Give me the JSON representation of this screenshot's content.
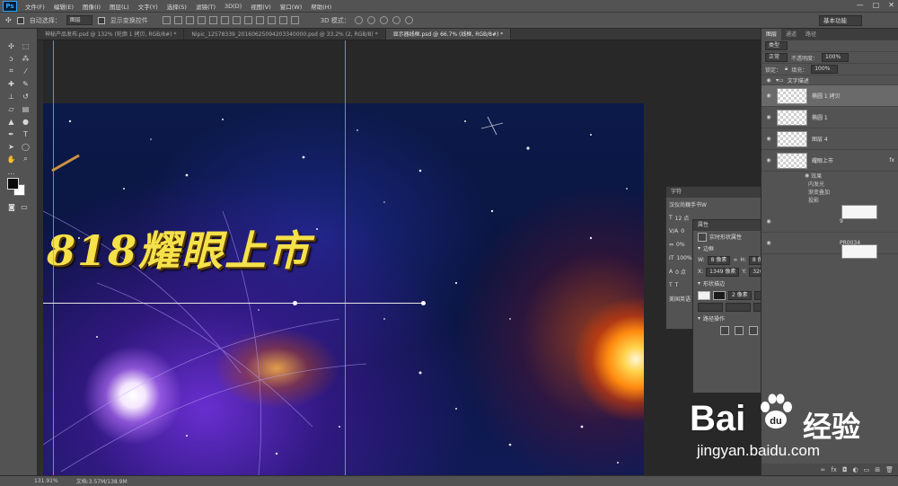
{
  "app": {
    "logo": "Ps"
  },
  "menu": [
    "文件(F)",
    "编辑(E)",
    "图像(I)",
    "图层(L)",
    "文字(Y)",
    "选择(S)",
    "滤镜(T)",
    "3D(D)",
    "视图(V)",
    "窗口(W)",
    "帮助(H)"
  ],
  "window_controls": {
    "minimize": "—",
    "maximize": "□",
    "close": "✕"
  },
  "options": {
    "auto_select_label": "自动选择：",
    "auto_select_value": "图层",
    "show_transform": "显示变换控件",
    "mode3d_label": "3D 模式：",
    "workspace": "基本功能"
  },
  "tabs": [
    {
      "label": "神秘产品发布.psd @ 132% (轮廓 1 拷贝, RGB/8#) *",
      "active": false
    },
    {
      "label": "Nipic_12578339_20160625094203340000.psd @ 33.2% (2, RGB/8) *",
      "active": false
    },
    {
      "label": "显示器线框.psd @ 66.7% (线框, RGB/8#) *",
      "active": true
    }
  ],
  "canvas": {
    "headline": "818耀眼上市"
  },
  "status": {
    "zoom": "131.91%",
    "doc": "文档:3.57M/138.9M"
  },
  "right_panel": {
    "tabs": [
      "图层",
      "通道",
      "路径"
    ],
    "filter_label": "类型",
    "blend_mode": "正常",
    "opacity_label": "不透明度：",
    "opacity": "100%",
    "lock_label": "锁定：",
    "fill_label": "填充：",
    "fill": "100%",
    "group_name": "文字描述",
    "layers": [
      {
        "name": "椭圆 1 拷贝",
        "selected": true
      },
      {
        "name": "椭圆 1",
        "selected": false
      },
      {
        "name": "图层 4",
        "selected": false
      },
      {
        "name": "耀眼上市",
        "selected": false,
        "fx": "fx"
      }
    ],
    "effects_label": "效果",
    "effects": [
      "内发光",
      "渐变叠加",
      "投影"
    ],
    "more_layers": [
      "9",
      "PR0034"
    ]
  },
  "char_panel": {
    "title": "字符",
    "font": "汉仪尚巍手书W",
    "size": "12 点",
    "leading": "0",
    "tracking": "0%",
    "scale": "100%",
    "baseline": "0 点",
    "language": "美国英语"
  },
  "props_panel": {
    "title": "属性",
    "subtitle": "实时形状属性",
    "section_transform": "边框",
    "w_label": "W:",
    "w": "8 像素",
    "h_label": "H:",
    "h": "8 像素",
    "x_label": "X:",
    "x": "1349 像素",
    "y_label": "Y:",
    "y": "320 像素",
    "section_stroke": "形状描边",
    "stroke_width": "2 像素",
    "section_path": "路径操作"
  },
  "watermark": {
    "brand1": "Bai",
    "brand2": "经验",
    "url": "jingyan.baidu.com"
  },
  "colors": {
    "accent": "#31a8ff",
    "panel": "#535353",
    "guide": "#4ec9c9",
    "headline": "#f5e14a"
  }
}
